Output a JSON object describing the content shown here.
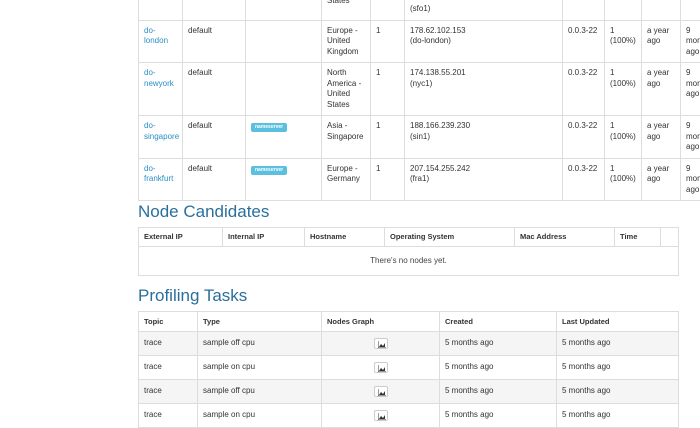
{
  "nodes": {
    "top_fragments": {
      "location": "States",
      "ip": "(sfo1)"
    },
    "rows": [
      {
        "name": "do-london",
        "group": "default",
        "badge": "",
        "location": "Europe - United Kingdom",
        "count": "1",
        "ip": "178.62.102.153",
        "region": "(do-london)",
        "version": "0.0.3-22",
        "conn": "1 (100%)",
        "created": "a year ago",
        "updated": "9 mon ago"
      },
      {
        "name": "do-newyork",
        "group": "default",
        "badge": "",
        "location": "North America - United States",
        "count": "1",
        "ip": "174.138.55.201",
        "region": "(nyc1)",
        "version": "0.0.3-22",
        "conn": "1 (100%)",
        "created": "a year ago",
        "updated": "9 mon ago"
      },
      {
        "name": "do-singapore",
        "group": "default",
        "badge": "nameserver",
        "location": "Asia - Singapore",
        "count": "1",
        "ip": "188.166.239.230",
        "region": "(sin1)",
        "version": "0.0.3-22",
        "conn": "1 (100%)",
        "created": "a year ago",
        "updated": "9 mon ago"
      },
      {
        "name": "do-frankfurt",
        "group": "default",
        "badge": "nameserver",
        "location": "Europe - Germany",
        "count": "1",
        "ip": "207.154.255.242",
        "region": "(fra1)",
        "version": "0.0.3-22",
        "conn": "1 (100%)",
        "created": "a year ago",
        "updated": "9 mon ago"
      }
    ]
  },
  "candidates": {
    "title": "Node Candidates",
    "headers": [
      "External IP",
      "Internal IP",
      "Hostname",
      "Operating System",
      "Mac Address",
      "Time"
    ],
    "empty": "There's no nodes yet."
  },
  "profiling": {
    "title": "Profiling Tasks",
    "headers": [
      "Topic",
      "Type",
      "Nodes Graph",
      "Created",
      "Last Updated"
    ],
    "rows": [
      {
        "topic": "trace",
        "type": "sample off cpu",
        "created": "5 months ago",
        "updated": "5 months ago"
      },
      {
        "topic": "trace",
        "type": "sample on cpu",
        "created": "5 months ago",
        "updated": "5 months ago"
      },
      {
        "topic": "trace",
        "type": "sample off cpu",
        "created": "5 months ago",
        "updated": "5 months ago"
      },
      {
        "topic": "trace",
        "type": "sample on cpu",
        "created": "5 months ago",
        "updated": "5 months ago"
      }
    ],
    "graph_icon": "area-chart-icon"
  },
  "colors": {
    "link": "#2a8fc7",
    "heading": "#2a6f9c",
    "badge": "#5bc0de"
  }
}
